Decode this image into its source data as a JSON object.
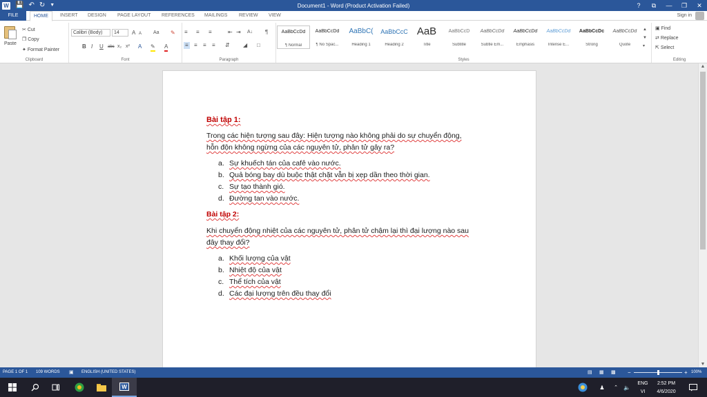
{
  "window": {
    "title": "Document1 - Word (Product Activation Failed)",
    "controls": {
      "help": "?",
      "restore_ribbon": "⧉",
      "minimize": "—",
      "maximize": "❐",
      "close": "✕"
    }
  },
  "quick_access": {
    "save_icon": "save-icon",
    "undo_icon": "undo-icon",
    "redo_icon": "redo-icon"
  },
  "tabs": [
    {
      "label": "FILE"
    },
    {
      "label": "HOME"
    },
    {
      "label": "INSERT"
    },
    {
      "label": "DESIGN"
    },
    {
      "label": "PAGE LAYOUT"
    },
    {
      "label": "REFERENCES"
    },
    {
      "label": "MAILINGS"
    },
    {
      "label": "REVIEW"
    },
    {
      "label": "VIEW"
    }
  ],
  "sign_in": "Sign in",
  "ribbon": {
    "clipboard": {
      "paste": "Paste",
      "cut": "Cut",
      "copy": "Copy",
      "format_painter": "Format Painter",
      "label": "Clipboard"
    },
    "font": {
      "font_name": "Calibri (Body)",
      "font_size": "14",
      "bold": "B",
      "italic": "I",
      "underline": "U",
      "strike": "abc",
      "subscript": "x₂",
      "superscript": "x²",
      "grow": "A",
      "shrink": "A",
      "case": "Aa",
      "label": "Font"
    },
    "paragraph": {
      "label": "Paragraph",
      "pilcrow": "¶"
    },
    "styles": {
      "label": "Styles",
      "items": [
        {
          "sample": "AaBbCcDd",
          "name": "¶ Normal"
        },
        {
          "sample": "AaBbCcDd",
          "name": "¶ No Spac..."
        },
        {
          "sample": "AaBbC(",
          "name": "Heading 1"
        },
        {
          "sample": "AaBbCcC",
          "name": "Heading 2"
        },
        {
          "sample": "AaB",
          "name": "Title"
        },
        {
          "sample": "AaBbCcD",
          "name": "Subtitle"
        },
        {
          "sample": "AaBbCcDd",
          "name": "Subtle Em..."
        },
        {
          "sample": "AaBbCcDd",
          "name": "Emphasis"
        },
        {
          "sample": "AaBbCcDd",
          "name": "Intense E..."
        },
        {
          "sample": "AaBbCcDc",
          "name": "Strong"
        },
        {
          "sample": "AaBbCcDd",
          "name": "Quote"
        }
      ]
    },
    "editing": {
      "find": "Find",
      "replace": "Replace",
      "select": "Select",
      "label": "Editing"
    }
  },
  "document": {
    "exercise1": {
      "heading": "Bài tập 1:",
      "question_line1": "Trong các hiện tượng sau đây: Hiện tượng nào không phải do sự chuyển động,",
      "question_line2": "hỗn độn không ngừng của các nguyên tử, phân tử gây ra?",
      "options": [
        {
          "marker": "a.",
          "text": "Sự khuếch tán của cafê vào nước."
        },
        {
          "marker": "b.",
          "text": "Quả bóng bay dù buộc thật chặt vẫn bị xẹp dần theo thời gian."
        },
        {
          "marker": "c.",
          "text": "Sự tạo thành gió."
        },
        {
          "marker": "d.",
          "text": "Đường tan vào nước."
        }
      ]
    },
    "exercise2": {
      "heading": "Bài tập 2:",
      "question_line1": "Khi chuyển động nhiệt của các nguyên tử, phân tử chậm lại thì đại lượng nào sau",
      "question_line2": "đây thay đổi?",
      "options": [
        {
          "marker": "a.",
          "text": "Khối lượng của vật"
        },
        {
          "marker": "b.",
          "text": "Nhiệt độ của vật"
        },
        {
          "marker": "c.",
          "text": "Thể tích của vật"
        },
        {
          "marker": "d.",
          "text": "Các đại lượng trên đều thay đổi"
        }
      ]
    }
  },
  "status": {
    "page": "PAGE 1 OF 1",
    "words": "109 WORDS",
    "language": "ENGLISH (UNITED STATES)",
    "zoom_out": "−",
    "zoom_in": "+",
    "zoom": "100%",
    "zoom_fraction": 0.5
  },
  "taskbar": {
    "lang_top": "ENG",
    "lang_bottom": "VI",
    "time": "2:52 PM",
    "date": "4/6/2020"
  }
}
